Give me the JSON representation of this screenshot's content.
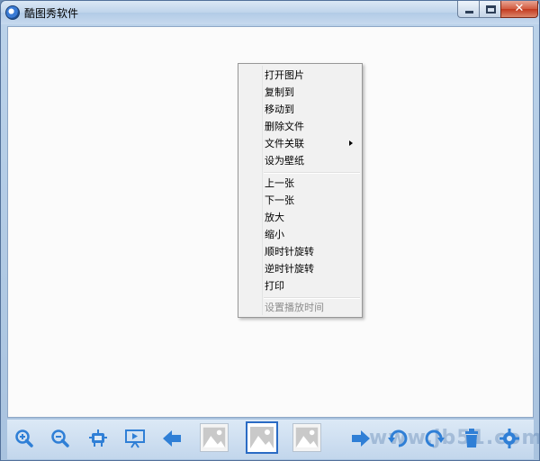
{
  "window": {
    "title": "酷图秀软件",
    "controls": {
      "close_glyph": "✕"
    }
  },
  "context_menu": {
    "groups": [
      [
        {
          "label": "打开图片"
        },
        {
          "label": "复制到"
        },
        {
          "label": "移动到"
        },
        {
          "label": "删除文件"
        },
        {
          "label": "文件关联",
          "has_submenu": true
        },
        {
          "label": "设为壁纸"
        }
      ],
      [
        {
          "label": "上一张"
        },
        {
          "label": "下一张"
        },
        {
          "label": "放大"
        },
        {
          "label": "缩小"
        },
        {
          "label": "顺时针旋转"
        },
        {
          "label": "逆时针旋转"
        },
        {
          "label": "打印"
        }
      ],
      [
        {
          "label": "设置播放时间",
          "disabled": true
        }
      ]
    ]
  },
  "toolbar": {
    "watermark": "www.jb51.com",
    "buttons": [
      {
        "name": "zoom-in-icon"
      },
      {
        "name": "zoom-out-icon"
      },
      {
        "name": "fit-icon"
      },
      {
        "name": "slideshow-icon"
      },
      {
        "name": "previous-icon"
      },
      {
        "name": "thumbnail-1"
      },
      {
        "name": "thumbnail-2-selected"
      },
      {
        "name": "thumbnail-3"
      },
      {
        "name": "next-icon"
      },
      {
        "name": "rotate-left-icon"
      },
      {
        "name": "rotate-right-icon"
      },
      {
        "name": "delete-icon"
      },
      {
        "name": "settings-icon"
      }
    ]
  },
  "colors": {
    "accent": "#2a6bc4",
    "icon_blue": "#2f7fd6",
    "menu_bg": "#f1f1f1",
    "disabled_text": "#8d8d8d"
  }
}
